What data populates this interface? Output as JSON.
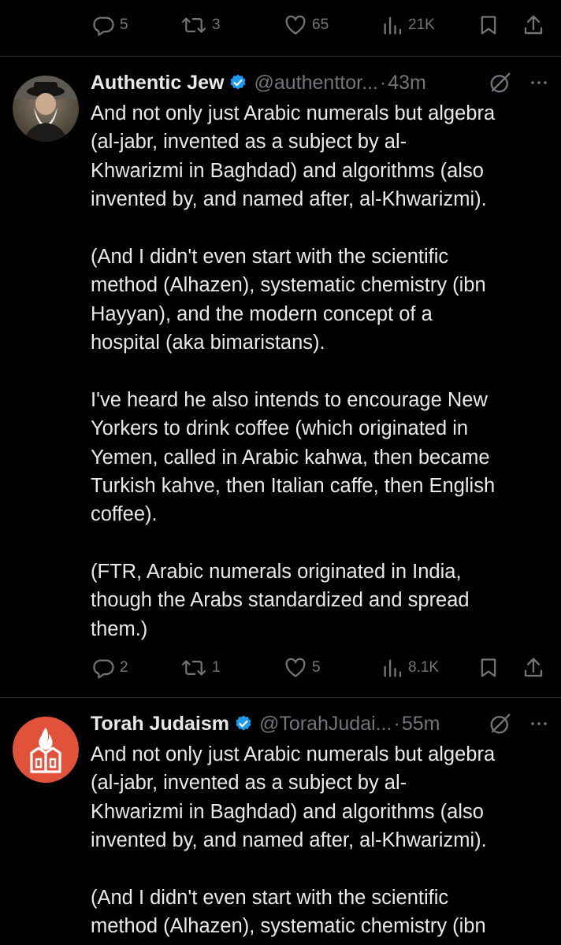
{
  "top_actions": {
    "replies": "5",
    "reposts": "3",
    "likes": "65",
    "views": "21K"
  },
  "tweets": [
    {
      "name": "Authentic Jew",
      "handle": "@authenttor...",
      "separator": "·",
      "time": "43m",
      "paragraphs": [
        "And not only just Arabic numerals but algebra\n(al-jabr, invented as a subject by al-\nKhwarizmi in Baghdad) and algorithms (also\ninvented by, and named after, al-Khwarizmi).",
        "(And I didn't even start with the scientific\nmethod (Alhazen), systematic chemistry (ibn\nHayyan), and the modern concept of a\nhospital (aka bimaristans).",
        "I've heard he also intends to encourage New\nYorkers to drink coffee (which originated in\nYemen, called in Arabic kahwa, then became\nTurkish kahve, then Italian caffe, then English\ncoffee).",
        "(FTR, Arabic numerals originated in India,\nthough the Arabs standardized and spread\nthem.)"
      ],
      "actions": {
        "replies": "2",
        "reposts": "1",
        "likes": "5",
        "views": "8.1K"
      }
    },
    {
      "name": "Torah Judaism",
      "handle": "@TorahJudai...",
      "separator": "·",
      "time": "55m",
      "paragraphs": [
        "And not only just Arabic numerals but algebra\n(al-jabr, invented as a subject by al-\nKhwarizmi in Baghdad) and algorithms (also\ninvented by, and named after, al-Khwarizmi).",
        "(And I didn't even start with the scientific\nmethod (Alhazen), systematic chemistry (ibn"
      ]
    }
  ],
  "icons": {
    "reply": "reply-icon",
    "repost": "repost-icon",
    "like": "like-icon",
    "views": "views-icon",
    "bookmark": "bookmark-icon",
    "share": "share-icon",
    "verified": "verified-badge-icon",
    "grok": "grok-icon",
    "more": "more-icon"
  },
  "colors": {
    "background": "#000000",
    "text": "#e7e9ea",
    "muted": "#71767b",
    "divider": "#2f3336",
    "verified": "#1d9bf0",
    "torah_avatar": "#e0533a"
  }
}
